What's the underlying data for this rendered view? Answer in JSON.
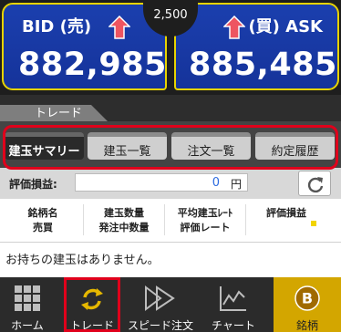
{
  "prices": {
    "bid_label": "BID (売)",
    "bid_value": "882,985",
    "ask_label": "(買) ASK",
    "ask_value": "885,485",
    "spread": "2,500"
  },
  "panel": {
    "title": "トレード",
    "tabs": [
      "建玉サマリー",
      "建玉一覧",
      "注文一覧",
      "約定履歴"
    ],
    "active_tab": "建玉サマリー"
  },
  "pl": {
    "label": "評価損益:",
    "value": "0",
    "unit": "円"
  },
  "columns": {
    "col1_line1": "銘柄名",
    "col1_line2": "売買",
    "col2_line1": "建玉数量",
    "col2_line2": "発注中数量",
    "col3_line1": "平均建玉ﾚｰﾄ",
    "col3_line2": "評価レート",
    "col4_line1": "評価損益",
    "col4_line2": ""
  },
  "empty_message": "お持ちの建玉はありません。",
  "nav": {
    "home": "ホーム",
    "trade": "トレード",
    "speed": "スピード注文",
    "chart": "チャート",
    "brand": "銘柄"
  },
  "colors": {
    "bid_ask_bg": "#1b3fae",
    "border_yellow": "#e8d400",
    "highlight_red": "#e0001b",
    "brand_gold": "#d3a600",
    "pl_blue": "#2c6be0"
  }
}
